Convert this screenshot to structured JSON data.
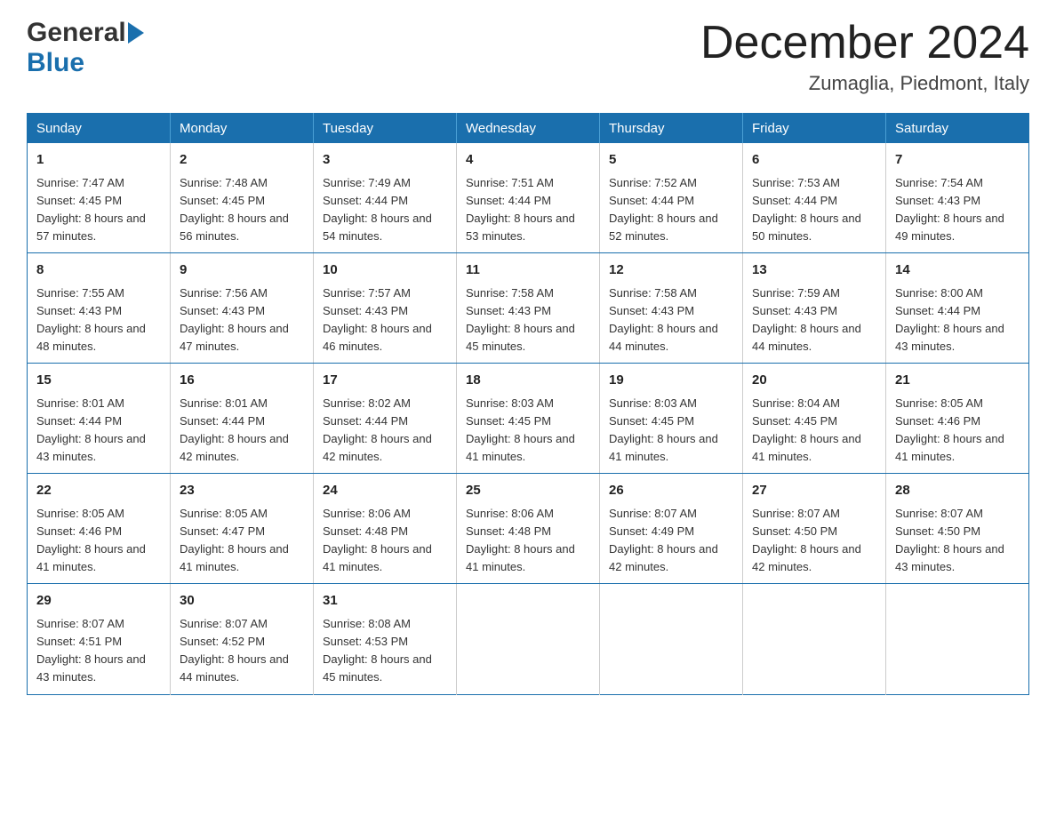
{
  "header": {
    "logo_general": "General",
    "logo_blue": "Blue",
    "month_title": "December 2024",
    "location": "Zumaglia, Piedmont, Italy"
  },
  "days_of_week": [
    "Sunday",
    "Monday",
    "Tuesday",
    "Wednesday",
    "Thursday",
    "Friday",
    "Saturday"
  ],
  "weeks": [
    [
      {
        "day": "1",
        "sunrise": "7:47 AM",
        "sunset": "4:45 PM",
        "daylight": "8 hours and 57 minutes."
      },
      {
        "day": "2",
        "sunrise": "7:48 AM",
        "sunset": "4:45 PM",
        "daylight": "8 hours and 56 minutes."
      },
      {
        "day": "3",
        "sunrise": "7:49 AM",
        "sunset": "4:44 PM",
        "daylight": "8 hours and 54 minutes."
      },
      {
        "day": "4",
        "sunrise": "7:51 AM",
        "sunset": "4:44 PM",
        "daylight": "8 hours and 53 minutes."
      },
      {
        "day": "5",
        "sunrise": "7:52 AM",
        "sunset": "4:44 PM",
        "daylight": "8 hours and 52 minutes."
      },
      {
        "day": "6",
        "sunrise": "7:53 AM",
        "sunset": "4:44 PM",
        "daylight": "8 hours and 50 minutes."
      },
      {
        "day": "7",
        "sunrise": "7:54 AM",
        "sunset": "4:43 PM",
        "daylight": "8 hours and 49 minutes."
      }
    ],
    [
      {
        "day": "8",
        "sunrise": "7:55 AM",
        "sunset": "4:43 PM",
        "daylight": "8 hours and 48 minutes."
      },
      {
        "day": "9",
        "sunrise": "7:56 AM",
        "sunset": "4:43 PM",
        "daylight": "8 hours and 47 minutes."
      },
      {
        "day": "10",
        "sunrise": "7:57 AM",
        "sunset": "4:43 PM",
        "daylight": "8 hours and 46 minutes."
      },
      {
        "day": "11",
        "sunrise": "7:58 AM",
        "sunset": "4:43 PM",
        "daylight": "8 hours and 45 minutes."
      },
      {
        "day": "12",
        "sunrise": "7:58 AM",
        "sunset": "4:43 PM",
        "daylight": "8 hours and 44 minutes."
      },
      {
        "day": "13",
        "sunrise": "7:59 AM",
        "sunset": "4:43 PM",
        "daylight": "8 hours and 44 minutes."
      },
      {
        "day": "14",
        "sunrise": "8:00 AM",
        "sunset": "4:44 PM",
        "daylight": "8 hours and 43 minutes."
      }
    ],
    [
      {
        "day": "15",
        "sunrise": "8:01 AM",
        "sunset": "4:44 PM",
        "daylight": "8 hours and 43 minutes."
      },
      {
        "day": "16",
        "sunrise": "8:01 AM",
        "sunset": "4:44 PM",
        "daylight": "8 hours and 42 minutes."
      },
      {
        "day": "17",
        "sunrise": "8:02 AM",
        "sunset": "4:44 PM",
        "daylight": "8 hours and 42 minutes."
      },
      {
        "day": "18",
        "sunrise": "8:03 AM",
        "sunset": "4:45 PM",
        "daylight": "8 hours and 41 minutes."
      },
      {
        "day": "19",
        "sunrise": "8:03 AM",
        "sunset": "4:45 PM",
        "daylight": "8 hours and 41 minutes."
      },
      {
        "day": "20",
        "sunrise": "8:04 AM",
        "sunset": "4:45 PM",
        "daylight": "8 hours and 41 minutes."
      },
      {
        "day": "21",
        "sunrise": "8:05 AM",
        "sunset": "4:46 PM",
        "daylight": "8 hours and 41 minutes."
      }
    ],
    [
      {
        "day": "22",
        "sunrise": "8:05 AM",
        "sunset": "4:46 PM",
        "daylight": "8 hours and 41 minutes."
      },
      {
        "day": "23",
        "sunrise": "8:05 AM",
        "sunset": "4:47 PM",
        "daylight": "8 hours and 41 minutes."
      },
      {
        "day": "24",
        "sunrise": "8:06 AM",
        "sunset": "4:48 PM",
        "daylight": "8 hours and 41 minutes."
      },
      {
        "day": "25",
        "sunrise": "8:06 AM",
        "sunset": "4:48 PM",
        "daylight": "8 hours and 41 minutes."
      },
      {
        "day": "26",
        "sunrise": "8:07 AM",
        "sunset": "4:49 PM",
        "daylight": "8 hours and 42 minutes."
      },
      {
        "day": "27",
        "sunrise": "8:07 AM",
        "sunset": "4:50 PM",
        "daylight": "8 hours and 42 minutes."
      },
      {
        "day": "28",
        "sunrise": "8:07 AM",
        "sunset": "4:50 PM",
        "daylight": "8 hours and 43 minutes."
      }
    ],
    [
      {
        "day": "29",
        "sunrise": "8:07 AM",
        "sunset": "4:51 PM",
        "daylight": "8 hours and 43 minutes."
      },
      {
        "day": "30",
        "sunrise": "8:07 AM",
        "sunset": "4:52 PM",
        "daylight": "8 hours and 44 minutes."
      },
      {
        "day": "31",
        "sunrise": "8:08 AM",
        "sunset": "4:53 PM",
        "daylight": "8 hours and 45 minutes."
      },
      null,
      null,
      null,
      null
    ]
  ]
}
